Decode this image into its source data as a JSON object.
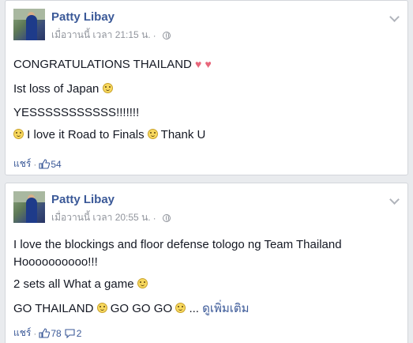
{
  "posts": [
    {
      "author": "Patty Libay",
      "timestamp": "เมื่อวานนี้ เวลา 21:15 น.",
      "lines": {
        "l1": "CONGRATULATIONS THAILAND",
        "l2": "Ist loss of Japan",
        "l3": "YESSSSSSSSSSS!!!!!!!",
        "l4a": "I love it Road to Finals",
        "l4b": "Thank U"
      },
      "share_label": "แชร์",
      "likes": "54",
      "icons": [
        "heart-icon",
        "smile-icon",
        "thumbs-up-icon",
        "globe-icon",
        "chevron-down-icon"
      ]
    },
    {
      "author": "Patty Libay",
      "timestamp": "เมื่อวานนี้ เวลา 20:55 น.",
      "lines": {
        "l1": "I love the blockings and floor defense tologo ng Team Thailand",
        "l2": "Hoooooooooo!!!",
        "l3": "2 sets all What a game",
        "l4a": "GO THAILAND",
        "l4b": "GO GO GO",
        "l4c": "...",
        "see_more": "ดูเพิ่มเติม"
      },
      "share_label": "แชร์",
      "likes": "78",
      "comments": "2",
      "icons": [
        "smile-icon",
        "thumbs-up-icon",
        "comment-icon",
        "globe-icon",
        "chevron-down-icon"
      ]
    }
  ],
  "colors": {
    "link": "#3b5998",
    "meta": "#90949c",
    "heart": "#e8667a",
    "background": "#e9ebee"
  }
}
